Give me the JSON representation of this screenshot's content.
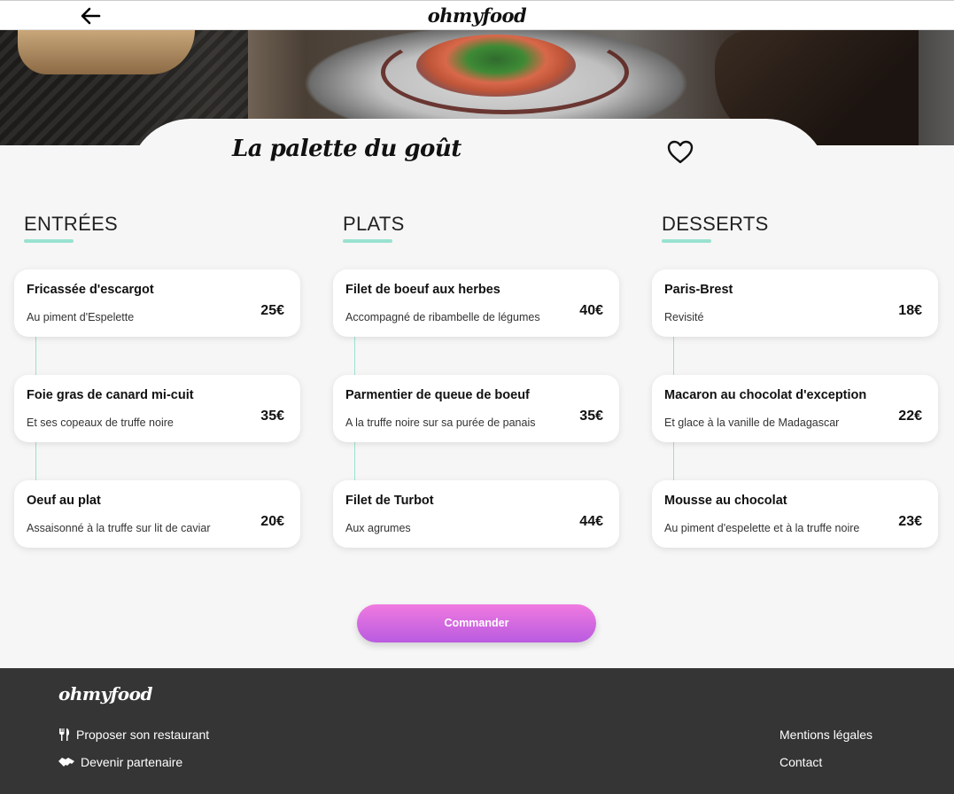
{
  "header": {
    "brand": "ohmyfood"
  },
  "restaurant": {
    "name": "La palette du goût"
  },
  "menu": {
    "columns": [
      {
        "title": "ENTRÉES",
        "items": [
          {
            "name": "Fricassée d'escargot",
            "desc": "Au piment d'Espelette",
            "price": "25€"
          },
          {
            "name": "Foie gras de canard mi-cuit",
            "desc": "Et ses copeaux de truffe noire",
            "price": "35€"
          },
          {
            "name": "Oeuf au plat",
            "desc": "Assaisonné à la truffe sur lit de caviar",
            "price": "20€"
          }
        ]
      },
      {
        "title": "PLATS",
        "items": [
          {
            "name": "Filet de boeuf aux herbes",
            "desc": "Accompagné de ribambelle de légumes",
            "price": "40€"
          },
          {
            "name": "Parmentier de queue de boeuf",
            "desc": "A la truffe noire sur sa purée de panais",
            "price": "35€"
          },
          {
            "name": "Filet de Turbot",
            "desc": "Aux agrumes",
            "price": "44€"
          }
        ]
      },
      {
        "title": "DESSERTS",
        "items": [
          {
            "name": "Paris-Brest",
            "desc": "Revisité",
            "price": "18€"
          },
          {
            "name": "Macaron au chocolat d'exception",
            "desc": "Et glace à la vanille de Madagascar",
            "price": "22€"
          },
          {
            "name": "Mousse au chocolat",
            "desc": "Au piment d'espelette et à la truffe noire",
            "price": "23€"
          }
        ]
      }
    ]
  },
  "order_button": "Commander",
  "footer": {
    "brand": "ohmyfood",
    "propose": "Proposer son restaurant",
    "partner": "Devenir partenaire",
    "legal": "Mentions légales",
    "contact": "Contact"
  },
  "colors": {
    "accent": "#99e2d0",
    "button_top": "#f07ae0",
    "button_bottom": "#b95be0",
    "footer_bg": "#353535"
  }
}
